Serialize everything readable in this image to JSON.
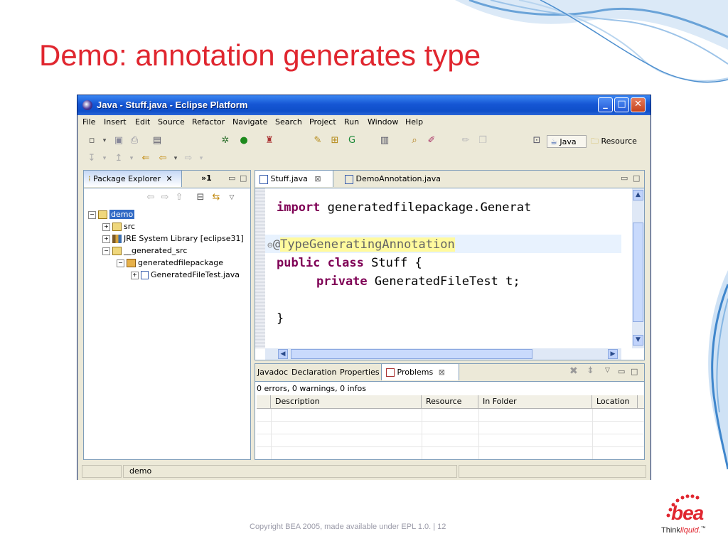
{
  "slide": {
    "title": "Demo: annotation generates type",
    "footer": "Copyright BEA 2005, made available under EPL 1.0.  |   12",
    "logo": {
      "brand": "bea",
      "tagline_think": "Think",
      "tagline_liquid": "liquid.",
      "tm": "™"
    }
  },
  "window": {
    "title": "Java - Stuff.java - Eclipse Platform",
    "controls": {
      "minimize": "_",
      "maximize": "□",
      "close": "✕"
    },
    "menu": [
      "File",
      "Insert",
      "Edit",
      "Source",
      "Refactor",
      "Navigate",
      "Search",
      "Project",
      "Run",
      "Window",
      "Help"
    ],
    "perspectives": {
      "java": "Java",
      "resource": "Resource"
    }
  },
  "package_explorer": {
    "tab_label": "Package Explorer",
    "overflow_label": "»1",
    "tree": [
      {
        "label": "demo",
        "level": 0,
        "toggle": "−",
        "selected": true
      },
      {
        "label": "src",
        "level": 1,
        "toggle": "+"
      },
      {
        "label": "JRE System Library [eclipse31]",
        "level": 1,
        "toggle": "+"
      },
      {
        "label": "__generated_src",
        "level": 1,
        "toggle": "−"
      },
      {
        "label": "generatedfilepackage",
        "level": 2,
        "toggle": "−"
      },
      {
        "label": "GeneratedFileTest.java",
        "level": 3,
        "toggle": "+"
      }
    ]
  },
  "editor": {
    "tabs": [
      {
        "label": "Stuff.java",
        "close": "⊠"
      },
      {
        "label": "DemoAnnotation.java"
      }
    ],
    "code": {
      "line1_kw": "import",
      "line1_rest": " generatedfilepackage.Generat",
      "line2_fold": "⊖",
      "line2_at": "@",
      "line2_ann": "TypeGeneratingAnnotation",
      "line3_kw1": "public",
      "line3_kw2": "class",
      "line3_rest": " Stuff {",
      "line4_kw": "private",
      "line4_rest": " GeneratedFileTest t;",
      "line5": "}"
    }
  },
  "bottom_panel": {
    "tabs": [
      "Javadoc",
      "Declaration",
      "Properties",
      "Problems"
    ],
    "summary": "0 errors, 0 warnings, 0 infos",
    "columns": [
      "Description",
      "Resource",
      "In Folder",
      "Location"
    ]
  },
  "status_bar": {
    "text": "demo"
  }
}
